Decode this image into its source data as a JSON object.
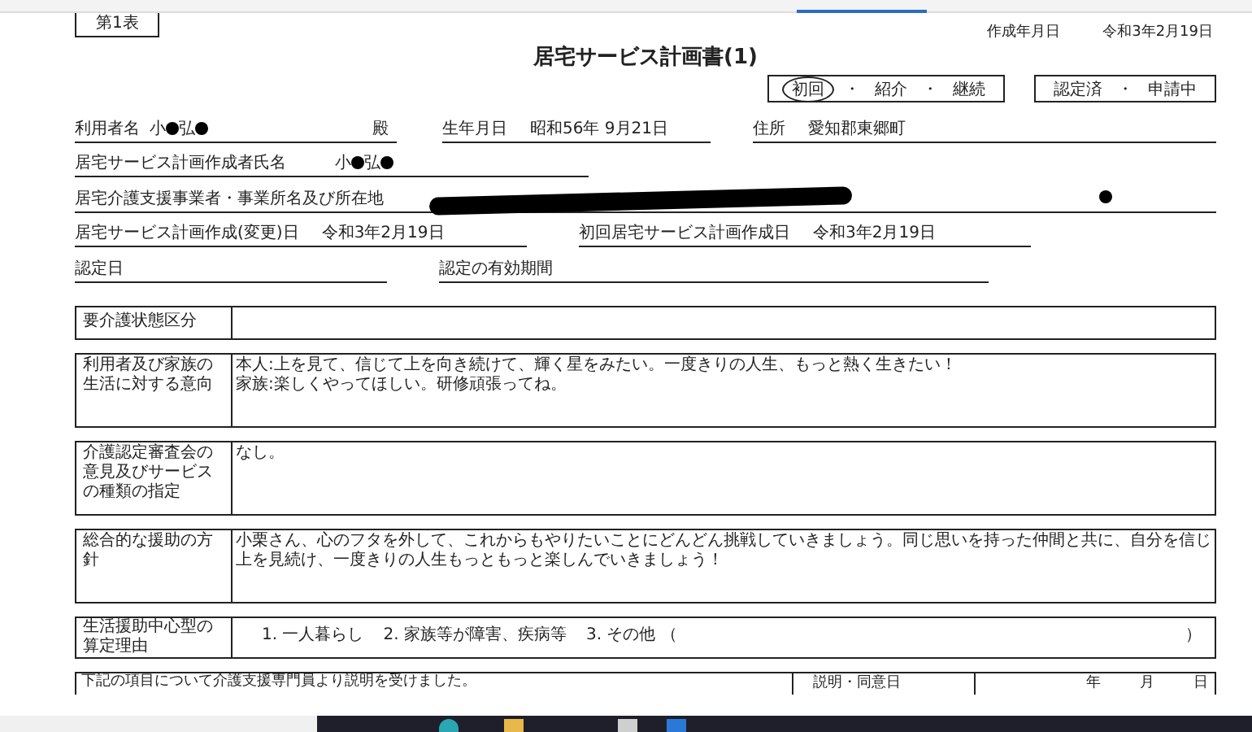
{
  "sheet_tag": "第1表",
  "created": {
    "label": "作成年月日",
    "value": "令和3年2月19日"
  },
  "title": "居宅サービス計画書(1)",
  "separator": "・",
  "referral_options": [
    {
      "label": "初回",
      "selected": true
    },
    {
      "label": "紹介",
      "selected": false
    },
    {
      "label": "継続",
      "selected": false
    }
  ],
  "certification_options": [
    {
      "label": "認定済",
      "selected": false
    },
    {
      "label": "申請中",
      "selected": false
    }
  ],
  "user": {
    "label": "利用者名",
    "name_parts": [
      "小",
      "弘"
    ],
    "honorific": "殿",
    "birth_label": "生年月日",
    "birth": "昭和56年  9月21日",
    "address_label": "住所",
    "address": "愛知郡東郷町"
  },
  "planner": {
    "label": "居宅サービス計画作成者氏名",
    "name_parts": [
      "小",
      "弘"
    ]
  },
  "office": {
    "label": "居宅介護支援事業者・事業所名及び所在地"
  },
  "plan_dates": [
    {
      "label": "居宅サービス計画作成(変更)日",
      "value": "令和3年2月19日"
    },
    {
      "label": "初回居宅サービス計画作成日",
      "value": "令和3年2月19日"
    }
  ],
  "cert_dates": [
    {
      "label": "認定日"
    },
    {
      "label": "認定の有効期間"
    }
  ],
  "sections": [
    {
      "kind": "box",
      "label": "要介護状態区分"
    },
    {
      "kind": "box",
      "label": "利用者及び家族の生活に対する意向",
      "lines": [
        "本人:上を見て、信じて上を向き続けて、輝く星をみたい。一度きりの人生、もっと熱く生きたい！",
        "家族:楽しくやってほしい。研修頑張ってね。"
      ]
    },
    {
      "kind": "box",
      "label": "介護認定審査会の意見及びサービスの種類の指定",
      "lines": [
        "なし。"
      ]
    },
    {
      "kind": "box",
      "label": "総合的な援助の方針",
      "lines": [
        "小栗さん、心のフタを外して、これからもやりたいことにどんどん挑戦していきましょう。同じ思いを持った仲間と共に、自分を信じ上を見続け、一度きりの人生もっともっと楽しんでいきましょう！"
      ]
    },
    {
      "kind": "reasons",
      "label": "生活援助中心型の算定理由",
      "reasons": [
        "1. 一人暮らし",
        "2. 家族等が障害、疾病等",
        "3. その他 （"
      ],
      "close": "）"
    }
  ],
  "consent": {
    "text": "下記の項目について介護支援専門員より説明を受けました。",
    "date_label": "説明・同意日",
    "date_parts": [
      "年",
      "月",
      "日"
    ]
  }
}
